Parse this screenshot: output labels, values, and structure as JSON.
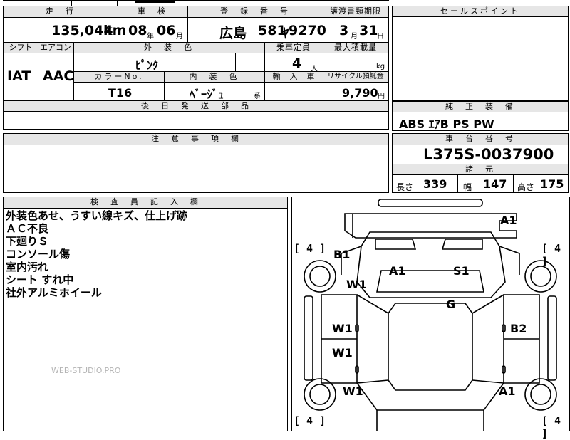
{
  "labels": {
    "mileage": "走　行",
    "inspection": "車　検",
    "registration": "登　録　番　号",
    "transfer_deadline": "譲渡書類期限",
    "sales_point": "セールスポイント",
    "shift": "シフト",
    "aircon": "エアコン",
    "exterior_color": "外　装　色",
    "capacity": "乗車定員",
    "max_load": "最大積載量",
    "color_no": "カラーNo.",
    "interior_color": "内　装　色",
    "import": "輸　入　車",
    "recycle_deposit": "リサイクル預託金",
    "later_parts": "後　日　発　送　部　品",
    "genuine_equipment": "純　正　装　備",
    "notes": "注　意　事　項　欄",
    "chassis_number": "車　台　番　号",
    "specs": "諸　元",
    "inspector_remarks": "検　査　員　記　入　欄"
  },
  "vehicle": {
    "mileage_value": "135,044",
    "mileage_unit": "km",
    "inspection_year": "08",
    "inspection_year_unit": "年",
    "inspection_month": "06",
    "inspection_month_unit": "月",
    "registration_area": "広島",
    "registration_class": "581",
    "registration_kana": "ﾔ",
    "registration_number": "9270",
    "deadline_month": "3",
    "deadline_month_unit": "月",
    "deadline_day": "31",
    "deadline_day_unit": "日",
    "shift_value": "IAT",
    "aircon_value": "AAC",
    "exterior_color_value": "ﾋﾟﾝｸ",
    "capacity_value": "4",
    "capacity_unit": "人",
    "max_load_unit": "kg",
    "color_no_value": "T16",
    "interior_color_value": "ﾍﾞｰｼﾞｭ",
    "interior_color_suffix": "系",
    "recycle_value": "9,790",
    "recycle_unit": "円",
    "genuine_equipment_value": "ABS ｴｱB PS PW",
    "chassis_number_value": "L375S-0037900",
    "length_label": "長さ",
    "length_value": "339",
    "width_label": "幅",
    "width_value": "147",
    "height_label": "高さ",
    "height_value": "175"
  },
  "remarks": [
    "外装色あせ、うすい線キズ、仕上げ跡",
    "ＡＣ不良",
    "下廻りＳ",
    "コンソール傷",
    "室内汚れ",
    "シート すれ中",
    "社外アルミホイール"
  ],
  "diagram": {
    "tire_marks": [
      "[ 4 ]",
      "[ 4 ]",
      "[ 4 ]",
      "[ 4 ]"
    ],
    "damage_codes": [
      "A1",
      "B1",
      "A1",
      "S1",
      "W1",
      "G",
      "W1",
      "B2",
      "W1",
      "W1",
      "A1"
    ]
  },
  "watermark": "WEB-STUDIO.PRO"
}
